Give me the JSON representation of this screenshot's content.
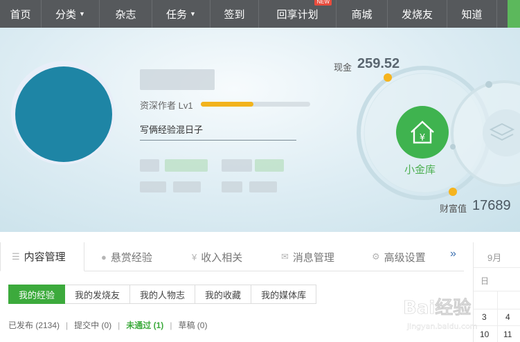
{
  "nav": {
    "items": [
      {
        "label": "首页"
      },
      {
        "label": "分类"
      },
      {
        "label": "杂志"
      },
      {
        "label": "任务"
      },
      {
        "label": "签到"
      },
      {
        "label": "回享计划"
      },
      {
        "label": "商城"
      },
      {
        "label": "发烧友"
      },
      {
        "label": "知道"
      }
    ],
    "new_badge": "NEW"
  },
  "profile": {
    "level_label": "资深作者 Lv1",
    "level_progress": 0.48,
    "motto": "写俩经验混日子"
  },
  "wallet": {
    "cash_label": "现金",
    "cash_value": "259.52",
    "vault_label": "小金库",
    "wealth_label": "财富值",
    "wealth_value": "17689"
  },
  "tabs": [
    {
      "label": "内容管理",
      "icon": "list-icon"
    },
    {
      "label": "悬赏经验",
      "icon": "coin-icon"
    },
    {
      "label": "收入相关",
      "icon": "yen-icon"
    },
    {
      "label": "消息管理",
      "icon": "mail-icon"
    },
    {
      "label": "高级设置",
      "icon": "gear-icon"
    }
  ],
  "tab_more": "»",
  "subtabs": [
    "我的经验",
    "我的发烧友",
    "我的人物志",
    "我的收藏",
    "我的媒体库"
  ],
  "stats": {
    "published": "已发布 (2134)",
    "submitting": "提交中 (0)",
    "failed": "未通过 (1)",
    "draft": "草稿 (0)"
  },
  "calendar": {
    "month": "9月",
    "weekday": "日",
    "cells": [
      "3",
      "4",
      "10",
      "11"
    ]
  },
  "watermark": {
    "brand": "Bai经验",
    "url": "jingyan.baidu.com"
  },
  "colors": {
    "nav_bg": "#56595c",
    "accent_green": "#3caa3c",
    "level_bar": "#f2b31c",
    "avatar": "#1e85a5"
  }
}
